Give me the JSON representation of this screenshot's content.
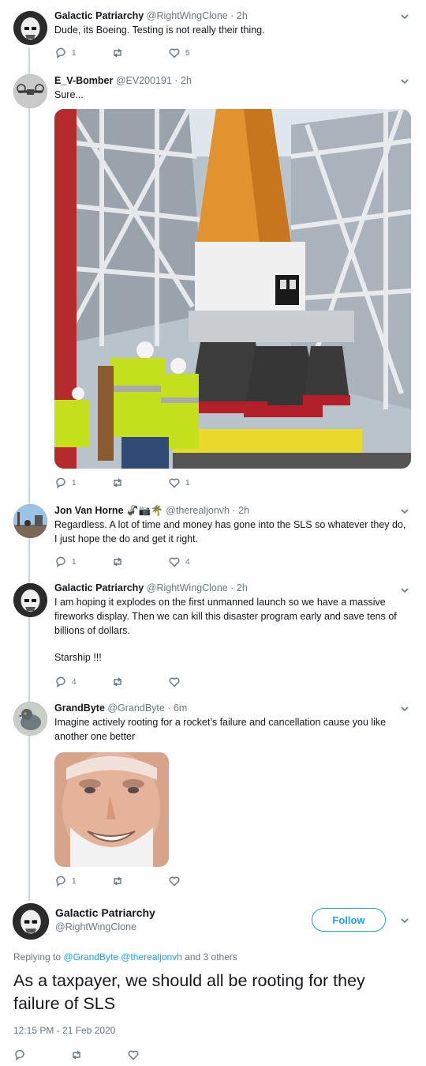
{
  "replies": [
    {
      "name": "Galactic Patriarchy",
      "handle": "@RightWingClone",
      "time": "2h",
      "text": "Dude, its Boeing. Testing is not really their thing.",
      "reply_count": "1",
      "retweet_count": "",
      "like_count": "5",
      "avatar": "stormtrooper"
    },
    {
      "name": "E_V-Bomber",
      "handle": "@EV200191",
      "time": "2h",
      "text": "Sure...",
      "reply_count": "1",
      "retweet_count": "",
      "like_count": "1",
      "avatar": "drone"
    },
    {
      "name": "Jon Van Horne",
      "name_emoji": "🦨📷🌴",
      "handle": "@therealjonvh",
      "time": "2h",
      "text": "Regardless. A lot of time and money has gone into the SLS so whatever they do, I just hope the do and get it right.",
      "reply_count": "1",
      "retweet_count": "",
      "like_count": "4",
      "avatar": "outdoor"
    },
    {
      "name": "Galactic Patriarchy",
      "handle": "@RightWingClone",
      "time": "2h",
      "text": "I am hoping it explodes on the first unmanned launch so we have a massive fireworks display. Then we can kill this disaster program early and save tens of billions of dollars.",
      "text2": "Starship !!!",
      "reply_count": "4",
      "retweet_count": "",
      "like_count": "",
      "avatar": "stormtrooper"
    },
    {
      "name": "GrandByte",
      "handle": "@GrandByte",
      "time": "6m",
      "text": "Imagine actively rooting for a rocket’s failure and cancellation cause you like another one better",
      "reply_count": "1",
      "retweet_count": "",
      "like_count": "",
      "avatar": "pigeon"
    }
  ],
  "main_tweet": {
    "name": "Galactic Patriarchy",
    "handle": "@RightWingClone",
    "follow_label": "Follow",
    "replying_prefix": "Replying to",
    "replying_to_1": "@GrandByte",
    "replying_to_2": "@therealjonvh",
    "replying_suffix": "and 3 others",
    "text": "As a taxpayer, we should all be rooting for they failure of SLS",
    "timestamp": "12:15 PM - 21 Feb 2020"
  },
  "colors": {
    "accent": "#1da1f2",
    "text": "#14171a",
    "muted": "#657786",
    "thread_line": "#ccd6dd"
  },
  "icons": [
    "reply-icon",
    "retweet-icon",
    "like-icon",
    "chevron-down-icon"
  ]
}
